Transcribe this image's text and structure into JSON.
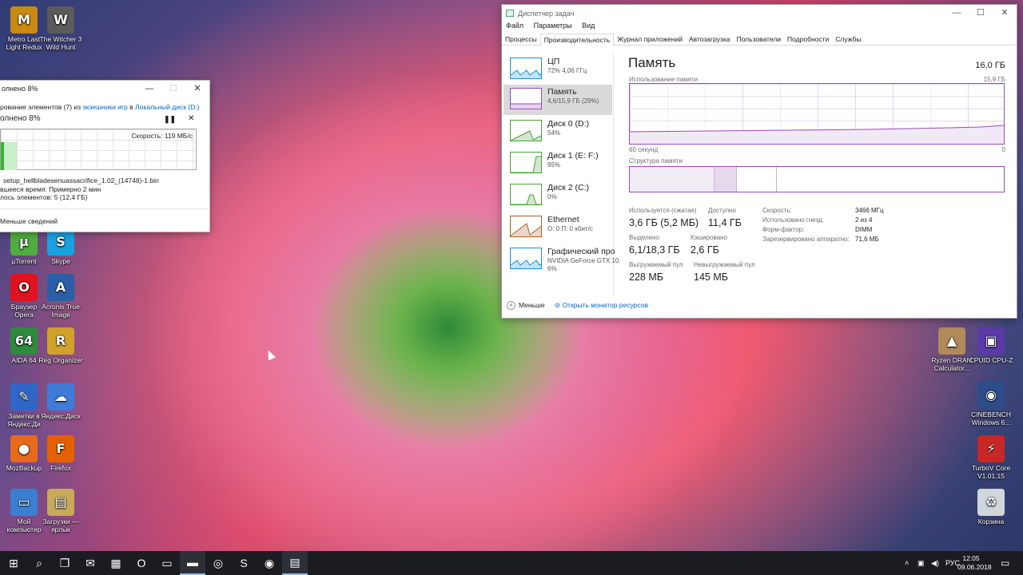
{
  "desktop_icons_left": [
    {
      "label": "Metro Last Light Redux",
      "icon": "metro-game-icon",
      "glyph": "M",
      "color": "#c98a12"
    },
    {
      "label": "The Witcher 3 Wild Hunt",
      "icon": "witcher-game-icon",
      "glyph": "W",
      "color": "#5b5b5b"
    },
    {
      "label": "µTorrent",
      "icon": "utorrent-icon",
      "glyph": "µ",
      "color": "#4fae3d"
    },
    {
      "label": "Skype",
      "icon": "skype-icon",
      "glyph": "S",
      "color": "#1aa1e0"
    },
    {
      "label": "Браузер Opera",
      "icon": "opera-icon",
      "glyph": "O",
      "color": "#e0121f"
    },
    {
      "label": "Acronis True Image",
      "icon": "acronis-icon",
      "glyph": "A",
      "color": "#2a5ea8"
    },
    {
      "label": "AIDA 64",
      "icon": "aida64-icon",
      "glyph": "64",
      "color": "#2e8b3d"
    },
    {
      "label": "Reg Organizer",
      "icon": "reg-organizer-icon",
      "glyph": "R",
      "color": "#d2a12a"
    },
    {
      "label": "Заметки в Яндекс.Ди",
      "icon": "yandex-notes-icon",
      "glyph": "✎",
      "color": "#2f66c8"
    },
    {
      "label": "Яндекс.Диск",
      "icon": "yandex-disk-icon",
      "glyph": "☁",
      "color": "#3f7bd9"
    },
    {
      "label": "MozBackup",
      "icon": "mozbackup-icon",
      "glyph": "●",
      "color": "#e86a1b"
    },
    {
      "label": "Firefox",
      "icon": "firefox-icon",
      "glyph": "F",
      "color": "#e66000"
    },
    {
      "label": "Мой компьютер",
      "icon": "my-computer-icon",
      "glyph": "▭",
      "color": "#3b7fd0"
    },
    {
      "label": "Загрузки — ярлык",
      "icon": "downloads-shortcut-icon",
      "glyph": "▤",
      "color": "#c9a95a"
    }
  ],
  "desktop_icons_right": [
    {
      "label": "Ryzen DRAM Calculator...",
      "icon": "ryzen-dram-icon",
      "glyph": "▲",
      "color": "#b08a5a"
    },
    {
      "label": "CPUID CPU-Z",
      "icon": "cpuz-icon",
      "glyph": "▣",
      "color": "#5b3aa8"
    },
    {
      "label": "CINEBENCH Windows 6...",
      "icon": "cinebench-icon",
      "glyph": "◉",
      "color": "#2c4d8a"
    },
    {
      "label": "TurboV Core V1.01.15",
      "icon": "turbov-icon",
      "glyph": "⚡",
      "color": "#c62727"
    },
    {
      "label": "Корзина",
      "icon": "recycle-bin-icon",
      "glyph": "♻",
      "color": "#cfd6dc"
    }
  ],
  "copy_dialog": {
    "title": "олнено 8%",
    "line_prefix": "рование элементов (7) из ",
    "source_link": "экзешники игр",
    "line_mid": " в ",
    "dest_link": "Локальный диск (D:)",
    "percent": "олнено 8%",
    "speed": "Скорость: 119 МБ/с",
    "name_label": "setup_hellbladesenuassacrifice_1.02_(14748)-1.bin",
    "time_label": "вшееся время:  Примерно 2 мин",
    "items_label": "лось элементов:  5 (12,4 ГБ)",
    "less_label": "Меньше сведений",
    "progress_fraction": 0.08
  },
  "task_manager": {
    "title": "Диспетчер задач",
    "menu": [
      "Файл",
      "Параметры",
      "Вид"
    ],
    "tabs": [
      "Процессы",
      "Производительность",
      "Журнал приложений",
      "Автозагрузка",
      "Пользователи",
      "Подробности",
      "Службы"
    ],
    "active_tab": "Производительность",
    "sidebar": [
      {
        "name": "ЦП",
        "sub": "72% 4,06 ГГц",
        "color": "#1a8fd8"
      },
      {
        "name": "Память",
        "sub": "4,6/15,9 ГБ (29%)",
        "color": "#9b4ab6"
      },
      {
        "name": "Диск 0 (D:)",
        "sub": "54%",
        "color": "#4aa13a"
      },
      {
        "name": "Диск 1 (E: F:)",
        "sub": "95%",
        "color": "#4aa13a"
      },
      {
        "name": "Диск 2 (C:)",
        "sub": "0%",
        "color": "#4aa13a"
      },
      {
        "name": "Ethernet",
        "sub": "О: 0 П: 0 кбит/с",
        "color": "#a8622c"
      },
      {
        "name": "Графический про",
        "sub": "NVIDIA GeForce GTX 10",
        "sub2": "6%",
        "color": "#1a8fd8"
      }
    ],
    "main": {
      "heading": "Память",
      "capacity": "16,0 ГБ",
      "usage_label": "Использование памяти",
      "usage_max": "15,9 ГБ",
      "x_left": "60 секунд",
      "x_right": "0",
      "structure_label": "Структура памяти",
      "stats": {
        "in_use_label": "Используется (сжатая)",
        "in_use": "3,6 ГБ (5,2 МБ)",
        "available_label": "Доступно",
        "available": "11,4 ГБ",
        "committed_label": "Выделено",
        "committed": "6,1/18,3 ГБ",
        "cached_label": "Кэшировано",
        "cached": "2,6 ГБ",
        "paged_label": "Выгружаемый пул",
        "paged": "228 МБ",
        "nonpaged_label": "Невыгружаемый пул",
        "nonpaged": "145 МБ"
      },
      "details": [
        {
          "k": "Скорость:",
          "v": "3466 МГц"
        },
        {
          "k": "Использовано гнезд:",
          "v": "2 из 4"
        },
        {
          "k": "Форм-фактор:",
          "v": "DIMM"
        },
        {
          "k": "Зарезервировано аппаратно:",
          "v": "71,6 МБ"
        }
      ]
    },
    "footer": {
      "less": "Меньше",
      "monitor": "Открыть монитор ресурсов"
    }
  },
  "taskbar": {
    "items": [
      {
        "icon": "start-windows-icon",
        "glyph": "⊞"
      },
      {
        "icon": "search-icon",
        "glyph": "⌕"
      },
      {
        "icon": "task-view-icon",
        "glyph": "❐"
      },
      {
        "icon": "mail-icon",
        "glyph": "✉"
      },
      {
        "icon": "calculator-icon",
        "glyph": "▦"
      },
      {
        "icon": "opera-taskbar-icon",
        "glyph": "O"
      },
      {
        "icon": "computer-taskbar-icon",
        "glyph": "▭"
      },
      {
        "icon": "explorer-taskbar-icon",
        "glyph": "▬",
        "active": true
      },
      {
        "icon": "steam-icon",
        "glyph": "◎"
      },
      {
        "icon": "skype-taskbar-icon",
        "glyph": "S"
      },
      {
        "icon": "firefox-taskbar-icon",
        "glyph": "◉"
      },
      {
        "icon": "taskmgr-taskbar-icon",
        "glyph": "▤",
        "active": true
      }
    ],
    "lang": "РУС",
    "time": "12:05",
    "date": "09.06.2018"
  }
}
